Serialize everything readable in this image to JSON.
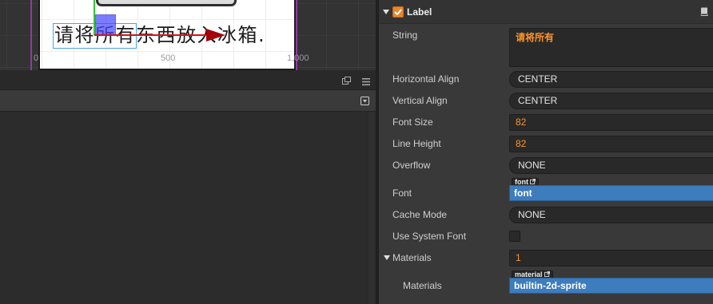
{
  "scene_view": {
    "canvas_label_text": "请将所有东西放入冰箱.",
    "ruler_labels": [
      "0",
      "500",
      "1,000"
    ],
    "gizmo": "move-gizmo-icon"
  },
  "bottom_panel": {
    "toolbar_icons": [
      "popout-icon",
      "menu-icon"
    ],
    "header_icon": "dropdown-icon"
  },
  "inspector": {
    "component": {
      "name": "Label",
      "enabled": true,
      "expanded": true,
      "help_icon": "book-icon"
    },
    "properties": {
      "string": {
        "label": "String",
        "value": "请将所有"
      },
      "horizontal_align": {
        "label": "Horizontal Align",
        "value": "CENTER"
      },
      "vertical_align": {
        "label": "Vertical Align",
        "value": "CENTER"
      },
      "font_size": {
        "label": "Font Size",
        "value": "82"
      },
      "line_height": {
        "label": "Line Height",
        "value": "82"
      },
      "overflow": {
        "label": "Overflow",
        "value": "NONE"
      },
      "font": {
        "label": "Font",
        "asset_type": "font",
        "value": "font"
      },
      "cache_mode": {
        "label": "Cache Mode",
        "value": "NONE"
      },
      "use_system_font": {
        "label": "Use System Font",
        "checked": false
      },
      "materials": {
        "label": "Materials",
        "count": "1",
        "expanded": true,
        "items": [
          {
            "label": "Materials",
            "asset_type": "material",
            "value": "builtin-2d-sprite"
          }
        ]
      }
    }
  },
  "colors": {
    "value_orange": "#fd942b",
    "checkbox_orange": "#e8862e",
    "asset_blue": "#3d7cbd",
    "selection_outline": "#4aa3e8",
    "gizmo_x_axis": "#d0151a",
    "gizmo_y_axis": "#34c234",
    "gizmo_center": "#4b4bff",
    "design_resolution_line": "#8e3aa8"
  }
}
